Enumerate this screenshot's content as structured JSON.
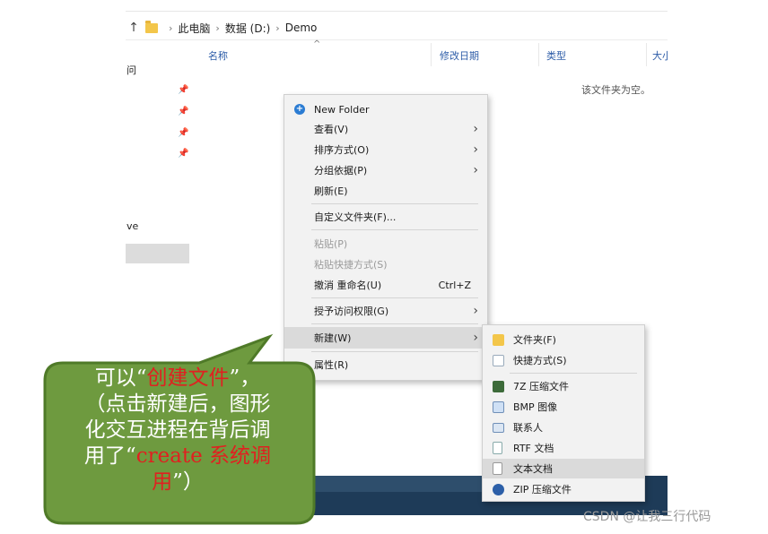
{
  "address": {
    "crumbs": [
      "此电脑",
      "数据 (D:)",
      "Demo"
    ]
  },
  "columns": {
    "name": "名称",
    "modified": "修改日期",
    "type": "类型",
    "size": "大小"
  },
  "left_pane": {
    "item_top": "问",
    "item_mid": "ve"
  },
  "empty_message": "该文件夹为空。",
  "context_menu": {
    "new_folder": "New Folder",
    "view": "查看(V)",
    "sort": "排序方式(O)",
    "group": "分组依据(P)",
    "refresh": "刷新(E)",
    "customize": "自定义文件夹(F)...",
    "paste": "粘贴(P)",
    "paste_shortcut": "粘贴快捷方式(S)",
    "undo_rename": "撤消 重命名(U)",
    "undo_shortcut": "Ctrl+Z",
    "grant_access": "授予访问权限(G)",
    "new": "新建(W)",
    "properties": "属性(R)"
  },
  "submenu": {
    "folder": "文件夹(F)",
    "shortcut": "快捷方式(S)",
    "zip7": "7Z 压缩文件",
    "bmp": "BMP 图像",
    "contact": "联系人",
    "rtf": "RTF 文档",
    "text": "文本文档",
    "zip": "ZIP 压缩文件"
  },
  "callout": {
    "line1_a": "可以“",
    "line1_red": "创建文件",
    "line1_b": "”，",
    "line2": "（点击新建后，图形",
    "line3": "化交互进程在背后调",
    "line4_a": "用了“",
    "line4_red": "create 系统调",
    "line5_red": "用",
    "line5_b": "”）"
  },
  "watermark": "CSDN @让我三行代码",
  "colors": {
    "callout_fill": "#6e9a3f",
    "callout_border": "#4f7a28",
    "highlight_red": "#e02020",
    "new_folder_icon": "#2b7cd3"
  }
}
